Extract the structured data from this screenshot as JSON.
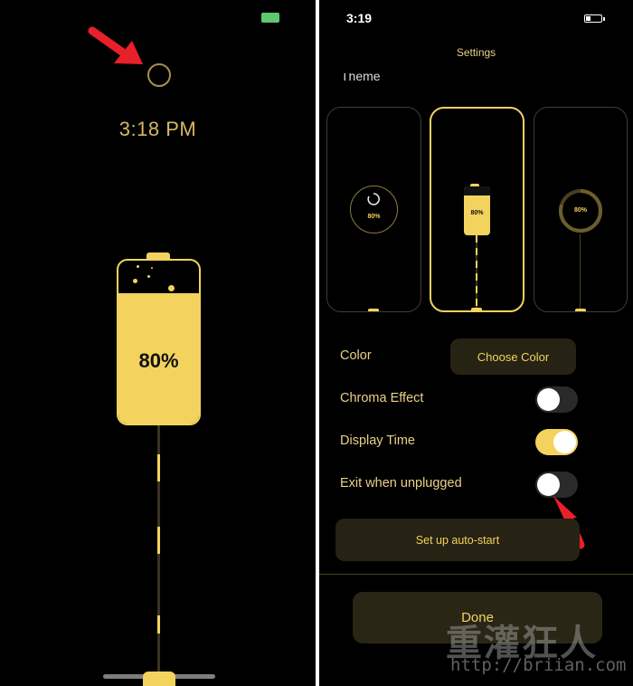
{
  "left": {
    "clock": "3:18 PM",
    "battery_percent_label": "80%",
    "battery_level": 0.8,
    "icons": [
      "status-battery-icon",
      "ring-button-icon",
      "red-arrow-icon"
    ]
  },
  "right": {
    "status_time": "3:19",
    "header_title": "Settings",
    "section_theme": "Theme",
    "theme_cards": [
      {
        "name": "ring",
        "percent": "80%",
        "selected": false
      },
      {
        "name": "battery",
        "percent": "80%",
        "selected": true
      },
      {
        "name": "gauge",
        "percent": "80%",
        "selected": false
      }
    ],
    "rows": {
      "color_label": "Color",
      "choose_color_button": "Choose Color",
      "chroma_label": "Chroma Effect",
      "chroma_on": false,
      "display_time_label": "Display Time",
      "display_time_on": true,
      "exit_label": "Exit when unplugged",
      "exit_on": false
    },
    "autostart_button": "Set up auto-start",
    "done_button": "Done"
  },
  "watermark": {
    "title": "重灌狂人",
    "url": "http://briian.com"
  },
  "colors": {
    "accent": "#f3d35e",
    "background": "#000000",
    "arrow": "#e8202a",
    "status_green": "#5fc86f"
  }
}
